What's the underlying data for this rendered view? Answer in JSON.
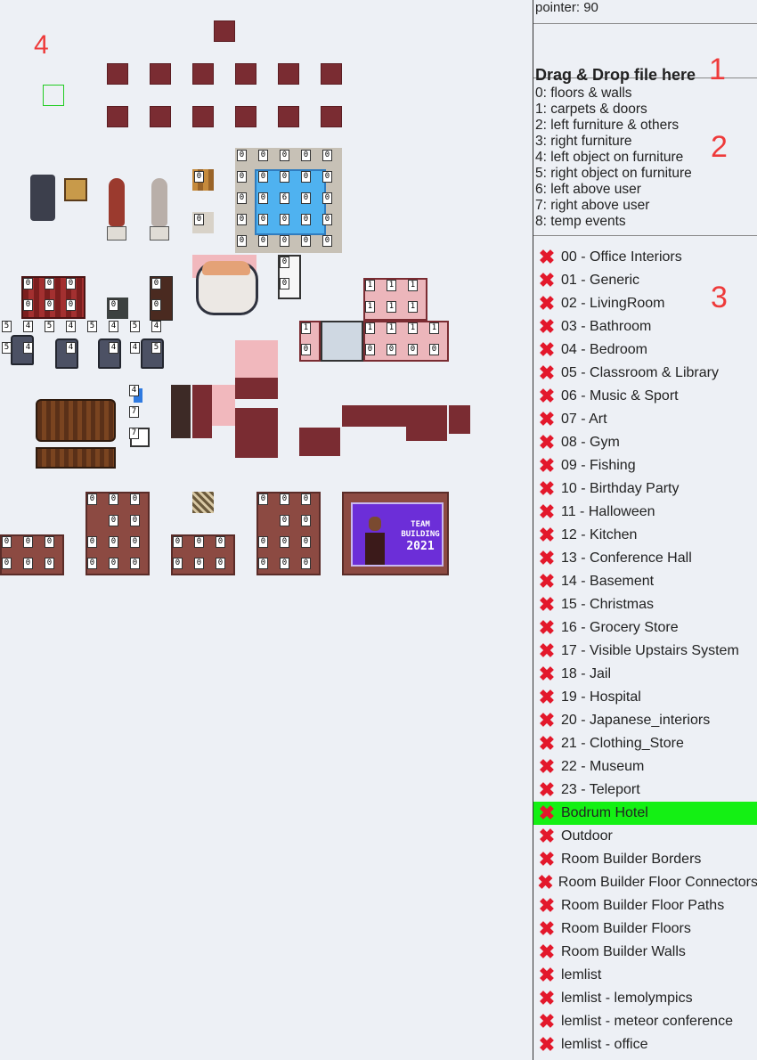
{
  "pointer_label": "pointer: 90",
  "drop": {
    "text": "Drag & Drop file here",
    "marker": "1"
  },
  "layers": {
    "marker": "2",
    "items": [
      "0: floors & walls",
      "1: carpets & doors",
      "2: left furniture & others",
      "3: right furniture",
      "4: left object on furniture",
      "5: right object on furniture",
      "6: left above user",
      "7: right above user",
      "8: temp events"
    ]
  },
  "tilesets": {
    "marker": "3",
    "remove_icon": "red-x-icon",
    "selected_color": "#14f014",
    "items": [
      "00 - Office Interiors",
      "01 - Generic",
      "02 - LivingRoom",
      "03 - Bathroom",
      "04 - Bedroom",
      "05 - Classroom & Library",
      "06 - Music & Sport",
      "07 - Art",
      "08 - Gym",
      "09 - Fishing",
      "10 - Birthday Party",
      "11 - Halloween",
      "12 - Kitchen",
      "13 - Conference Hall",
      "14 - Basement",
      "15 - Christmas",
      "16 - Grocery Store",
      "17 - Visible Upstairs System",
      "18 - Jail",
      "19 - Hospital",
      "20 - Japanese_interiors",
      "21 - Clothing_Store",
      "22 - Museum",
      "23 - Teleport",
      "Bodrum Hotel",
      "Outdoor",
      "Room Builder Borders",
      "Room Builder Floor Connectors",
      "Room Builder Floor Paths",
      "Room Builder Floors",
      "Room Builder Walls",
      "lemlist",
      "lemlist - lemolympics",
      "lemlist - meteor conference",
      "lemlist - office"
    ],
    "selected_index": 24
  },
  "canvas": {
    "marker": "4",
    "poster": {
      "line1": "TEAM",
      "line2": "BUILDING",
      "line3": "2021"
    }
  }
}
